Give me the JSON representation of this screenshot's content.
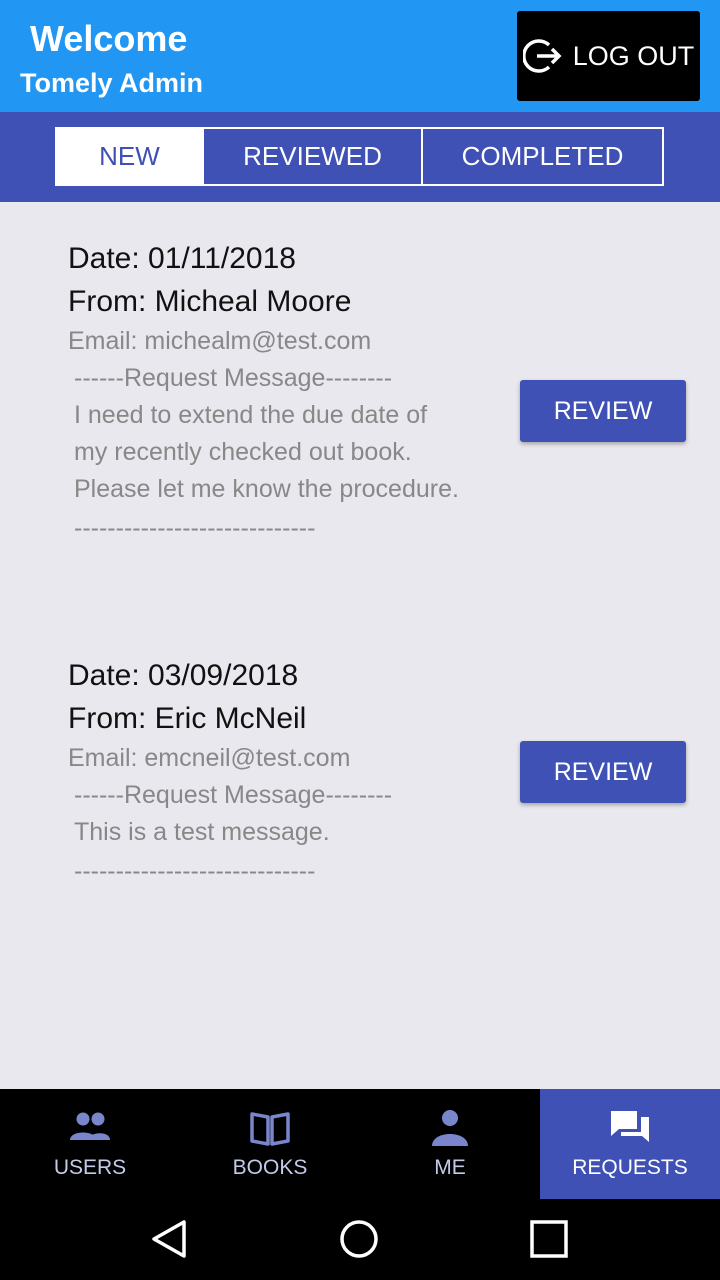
{
  "header": {
    "welcome": "Welcome",
    "subtitle": "Tomely Admin",
    "logout_label": "LOG OUT"
  },
  "tabs": [
    {
      "label": "NEW",
      "active": true
    },
    {
      "label": "REVIEWED",
      "active": false
    },
    {
      "label": "COMPLETED",
      "active": false
    }
  ],
  "requests": [
    {
      "date": "Date: 01/11/2018",
      "from": "From: Micheal Moore",
      "email": "Email: michealm@test.com",
      "header_line": "------Request Message--------",
      "message": "I need to extend the due date of my recently checked out book. Please let me know the procedure.",
      "footer_line": "-----------------------------",
      "action_label": "REVIEW"
    },
    {
      "date": "Date: 03/09/2018",
      "from": "From: Eric McNeil",
      "email": "Email: emcneil@test.com",
      "header_line": "------Request Message--------",
      "message": "This is a test message.",
      "footer_line": "-----------------------------",
      "action_label": "REVIEW"
    }
  ],
  "bottom_nav": [
    {
      "label": "USERS",
      "icon": "users-icon"
    },
    {
      "label": "BOOKS",
      "icon": "book-icon"
    },
    {
      "label": "ME",
      "icon": "person-icon"
    },
    {
      "label": "REQUESTS",
      "icon": "chat-icon",
      "active": true
    }
  ],
  "colors": {
    "header": "#2196f3",
    "primary": "#3f51b5",
    "background": "#e8e8ee"
  }
}
